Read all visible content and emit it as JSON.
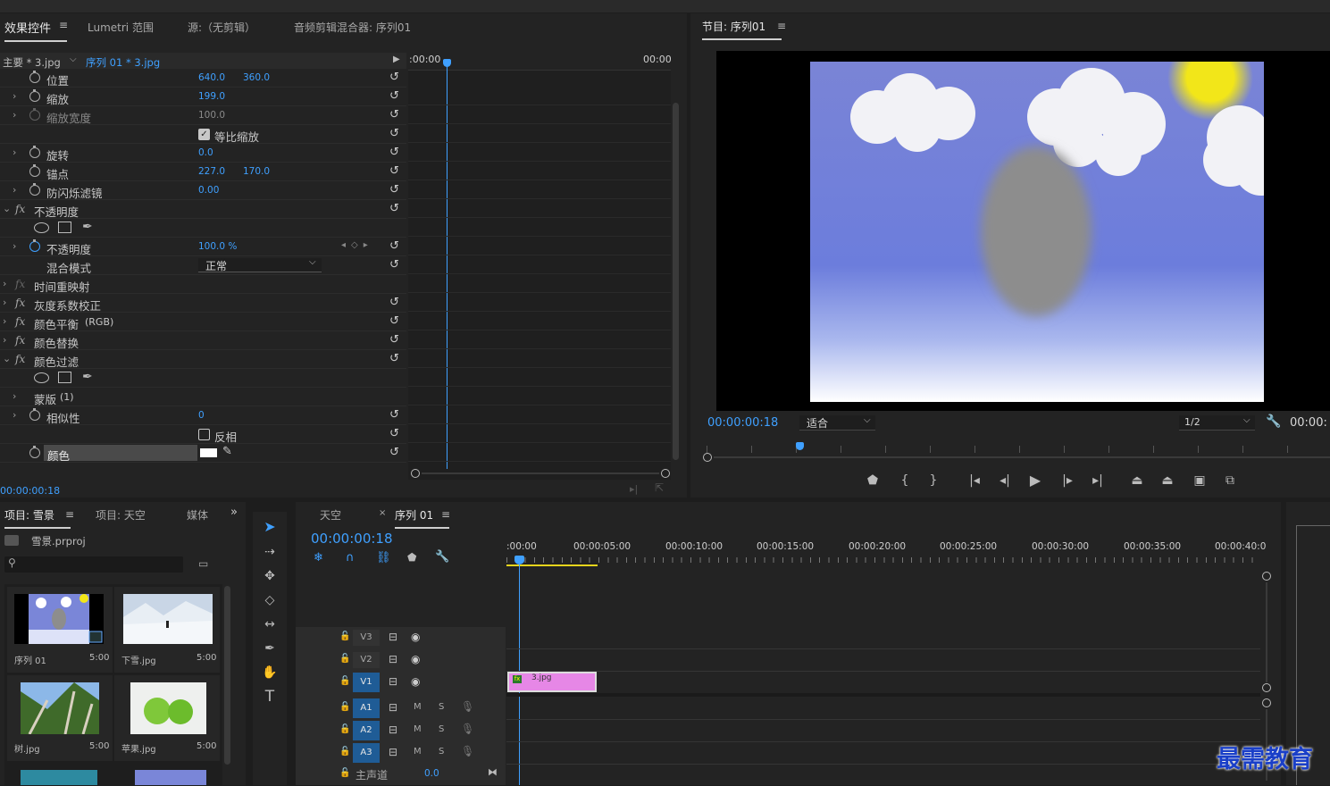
{
  "effects_panel": {
    "tabs": [
      "效果控件",
      "Lumetri 范围",
      "源:（无剪辑）",
      "音频剪辑混合器: 序列01"
    ],
    "master_clip": "主要 * 3.jpg",
    "sequence_clip": "序列 01 * 3.jpg",
    "timecode_start": ":00:00",
    "timecode_end": "00:00",
    "current_time": "00:00:00:18",
    "rows": [
      {
        "label": "位置",
        "v1": "640.0",
        "v2": "360.0"
      },
      {
        "label": "缩放",
        "v1": "199.0"
      },
      {
        "label": "缩放宽度",
        "v1": "100.0"
      },
      {
        "label": "等比缩放"
      },
      {
        "label": "旋转",
        "v1": "0.0"
      },
      {
        "label": "锚点",
        "v1": "227.0",
        "v2": "170.0"
      },
      {
        "label": "防闪烁滤镜",
        "v1": "0.00"
      },
      {
        "label": "不透明度"
      },
      {
        "label": "不透明度",
        "v1": "100.0 %"
      },
      {
        "label": "混合模式",
        "dropdown": "正常"
      },
      {
        "label": "时间重映射"
      },
      {
        "label": "灰度系数校正"
      },
      {
        "label": "颜色平衡",
        "suffix": "(RGB)"
      },
      {
        "label": "颜色替换"
      },
      {
        "label": "颜色过滤"
      },
      {
        "label": "蒙版",
        "suffix": "(1)"
      },
      {
        "label": "相似性",
        "v1": "0"
      },
      {
        "label": "反相"
      },
      {
        "label": "颜色"
      }
    ]
  },
  "program_monitor": {
    "title": "节目: 序列01",
    "timecode": "00:00:00:18",
    "fit": "适合",
    "quality": "1/2",
    "end_time": "00:00:"
  },
  "project_panel": {
    "tabs": [
      "项目: 雪景",
      "项目: 天空",
      "媒体"
    ],
    "file": "雪景.prproj",
    "items": [
      {
        "name": "序列 01",
        "dur": "5:00"
      },
      {
        "name": "下雪.jpg",
        "dur": "5:00"
      },
      {
        "name": "树.jpg",
        "dur": "5:00"
      },
      {
        "name": "苹果.jpg",
        "dur": "5:00"
      }
    ]
  },
  "timeline": {
    "tabs": [
      "天空",
      "序列 01"
    ],
    "timecode": "00:00:00:18",
    "ruler": [
      ":00:00",
      "00:00:05:00",
      "00:00:10:00",
      "00:00:15:00",
      "00:00:20:00",
      "00:00:25:00",
      "00:00:30:00",
      "00:00:35:00",
      "00:00:40:0"
    ],
    "video_tracks": [
      "V3",
      "V2",
      "V1"
    ],
    "audio_tracks": [
      "A1",
      "A2",
      "A3"
    ],
    "master": "主声道",
    "master_value": "0.0",
    "clip_name": "3.jpg",
    "m": "M",
    "s": "S"
  },
  "watermark": "最需教育",
  "colors": {
    "accent": "#3fa0ff",
    "clip": "#e687e6",
    "sky": "#7080d8"
  }
}
